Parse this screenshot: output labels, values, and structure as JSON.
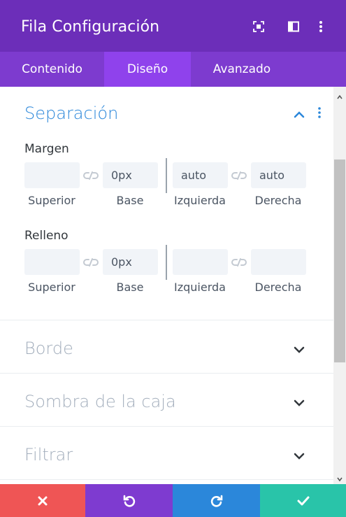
{
  "header": {
    "title": "Fila Configuración",
    "icons": [
      "focus-icon",
      "sidebar-toggle-icon",
      "more-vertical-icon"
    ]
  },
  "tabs": [
    {
      "label": "Contenido",
      "active": false
    },
    {
      "label": "Diseño",
      "active": true
    },
    {
      "label": "Avanzado",
      "active": false
    }
  ],
  "sections": {
    "spacing": {
      "title": "Separación",
      "expanded": true,
      "margin": {
        "label": "Margen",
        "top": {
          "value": "",
          "label": "Superior"
        },
        "bottom": {
          "value": "0px",
          "label": "Base"
        },
        "left": {
          "value": "auto",
          "label": "Izquierda"
        },
        "right": {
          "value": "auto",
          "label": "Derecha"
        }
      },
      "padding": {
        "label": "Relleno",
        "top": {
          "value": "",
          "label": "Superior"
        },
        "bottom": {
          "value": "0px",
          "label": "Base"
        },
        "left": {
          "value": "",
          "label": "Izquierda"
        },
        "right": {
          "value": "",
          "label": "Derecha"
        }
      }
    },
    "border": {
      "title": "Borde",
      "expanded": false
    },
    "box_shadow": {
      "title": "Sombra de la caja",
      "expanded": false
    },
    "filter": {
      "title": "Filtrar",
      "expanded": false
    }
  },
  "footer": {
    "buttons": [
      {
        "name": "discard",
        "icon": "close-icon",
        "color": "#ef5555"
      },
      {
        "name": "undo",
        "icon": "undo-icon",
        "color": "#7e3bd0"
      },
      {
        "name": "redo",
        "icon": "redo-icon",
        "color": "#2b87da"
      },
      {
        "name": "save",
        "icon": "check-icon",
        "color": "#29c4a9"
      }
    ]
  },
  "colors": {
    "header_bg": "#6c2eb9",
    "tabs_bg": "#7d3bcf",
    "active_tab_bg": "#8f42ec",
    "accent_blue": "#2b87da"
  }
}
